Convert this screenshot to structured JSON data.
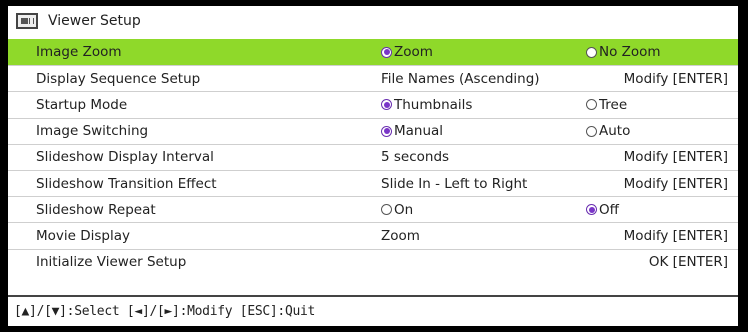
{
  "window": {
    "title": "Viewer Setup",
    "icon": "viewer-icon"
  },
  "rows": [
    {
      "name": "Image Zoom",
      "active": true,
      "type": "radio",
      "options": [
        {
          "label": "Zoom",
          "selected": true
        },
        {
          "label": "No Zoom",
          "selected": false
        }
      ]
    },
    {
      "name": "Display Sequence Setup",
      "type": "value",
      "value": "File Names (Ascending)",
      "action": "Modify [ENTER]"
    },
    {
      "name": "Startup Mode",
      "type": "radio",
      "options": [
        {
          "label": "Thumbnails",
          "selected": true
        },
        {
          "label": "Tree",
          "selected": false
        }
      ]
    },
    {
      "name": "Image Switching",
      "type": "radio",
      "options": [
        {
          "label": "Manual",
          "selected": true
        },
        {
          "label": "Auto",
          "selected": false
        }
      ]
    },
    {
      "name": "Slideshow Display Interval",
      "type": "value",
      "value": "5 seconds",
      "action": "Modify [ENTER]"
    },
    {
      "name": "Slideshow Transition Effect",
      "type": "value",
      "value": "Slide In - Left to Right",
      "action": "Modify [ENTER]"
    },
    {
      "name": "Slideshow Repeat",
      "type": "radio",
      "options": [
        {
          "label": "On",
          "selected": false
        },
        {
          "label": "Off",
          "selected": true
        }
      ]
    },
    {
      "name": "Movie Display",
      "type": "value",
      "value": "Zoom",
      "action": "Modify [ENTER]"
    },
    {
      "name": "Initialize Viewer Setup",
      "type": "action",
      "action": "OK [ENTER]"
    }
  ],
  "statusbar": {
    "text": "[▲]/[▼]:Select  [◄]/[►]:Modify  [ESC]:Quit"
  },
  "colors": {
    "highlight": "#8fd92a",
    "radio_selected": "#7a35c8",
    "background": "#ffffff",
    "frame": "#000000"
  }
}
